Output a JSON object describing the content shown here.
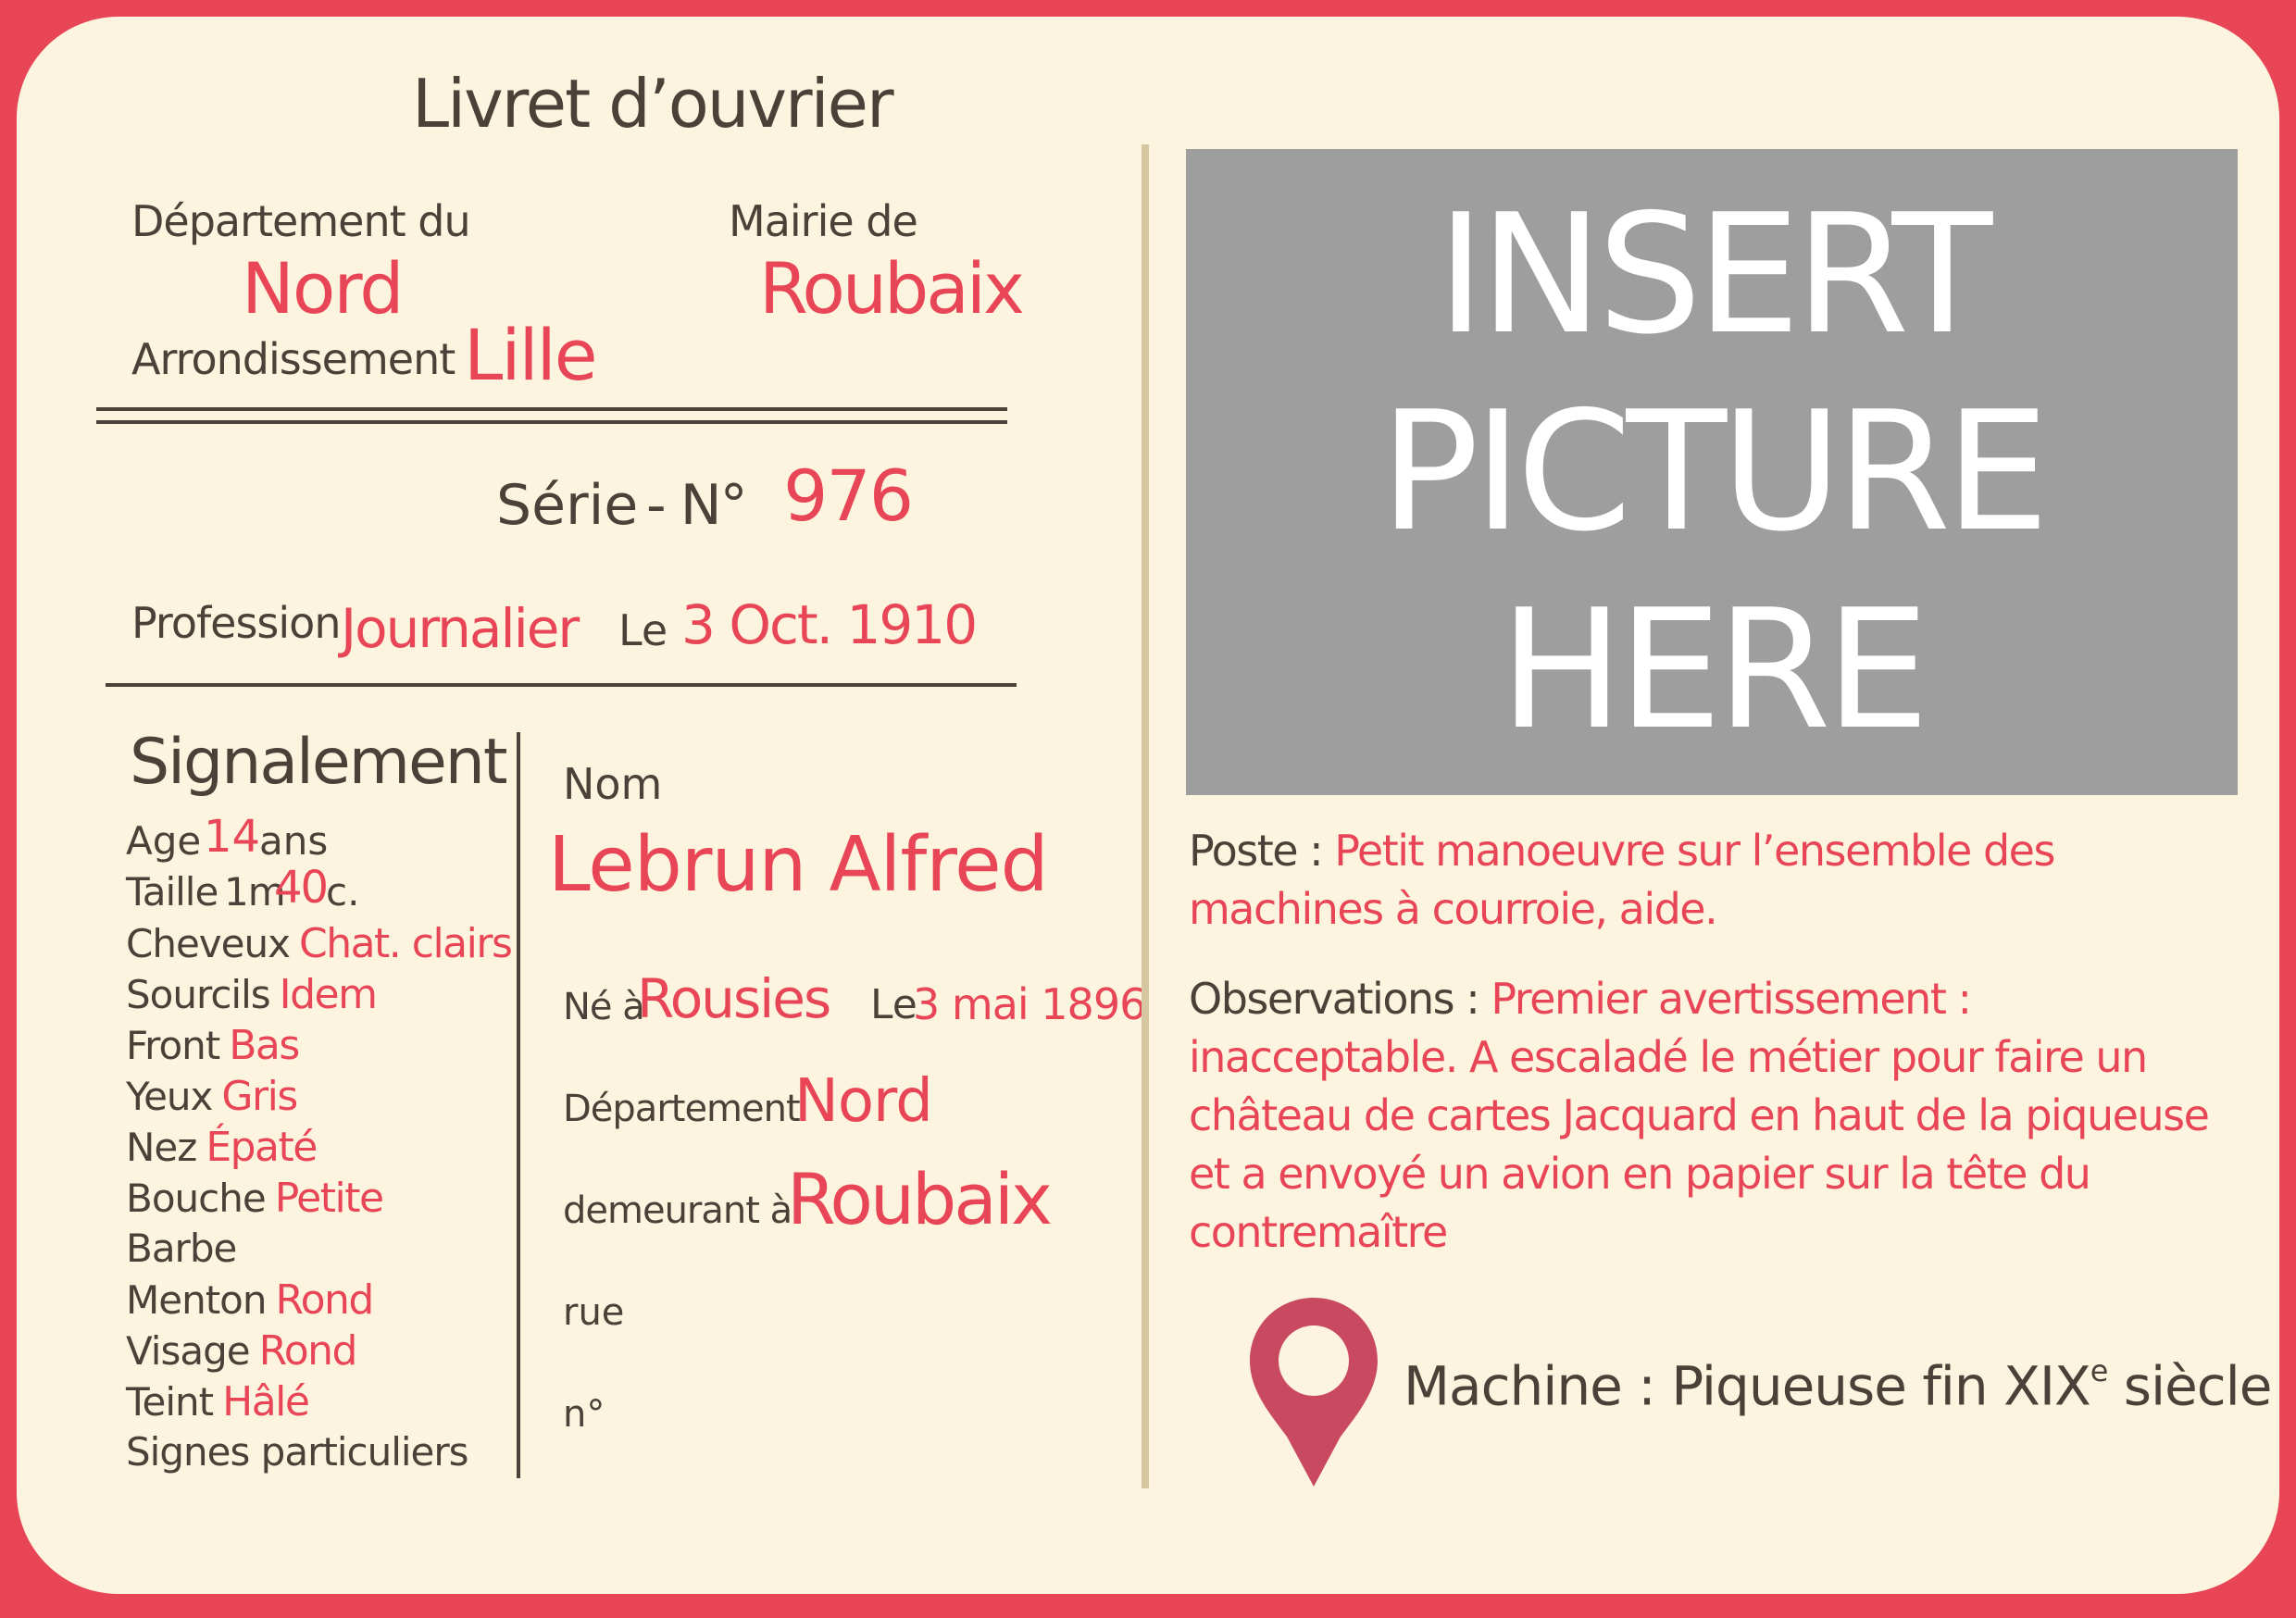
{
  "header": {
    "title": "Livret d’ouvrier"
  },
  "admin": {
    "departement_label": "Département du",
    "departement_value": "Nord",
    "mairie_label": "Mairie de",
    "mairie_value": "Roubaix",
    "arrondissement_label": "Arrondissement",
    "arrondissement_value": "Lille"
  },
  "serie": {
    "label": "Série",
    "no_label": "- N°",
    "number": "976"
  },
  "profession": {
    "label": "Profession",
    "value": "Journalier",
    "date_label": "Le",
    "date_value": "3 Oct. 1910"
  },
  "signalement": {
    "title": "Signalement",
    "age_label": "Age",
    "age_value": "14",
    "age_unit": "ans",
    "taille_label": "Taille",
    "taille_m": "1m",
    "taille_cm": "40",
    "taille_unit": "c.",
    "items": [
      {
        "label": "Cheveux",
        "value": "Chat. clairs"
      },
      {
        "label": "Sourcils",
        "value": "Idem"
      },
      {
        "label": "Front",
        "value": "Bas"
      },
      {
        "label": "Yeux",
        "value": "Gris"
      },
      {
        "label": "Nez",
        "value": "Épaté"
      },
      {
        "label": "Bouche",
        "value": "Petite"
      },
      {
        "label": "Barbe",
        "value": ""
      },
      {
        "label": "Menton",
        "value": "Rond"
      },
      {
        "label": "Visage",
        "value": "Rond"
      },
      {
        "label": "Teint",
        "value": "Hâlé"
      },
      {
        "label": "Signes particuliers",
        "value": ""
      }
    ]
  },
  "identity": {
    "nom_label": "Nom",
    "nom_value": "Lebrun Alfred",
    "ne_label": "Né à",
    "ne_value": "Rousies",
    "le_label": "Le",
    "le_value": "3 mai 1896",
    "dep_label": "Département",
    "dep_value": "Nord",
    "demeurant_label": "demeurant à",
    "demeurant_value": "Roubaix",
    "rue_label": "rue",
    "no_label": "n°"
  },
  "photo": {
    "placeholder": "INSERT\nPICTURE\nHERE"
  },
  "poste": {
    "label": "Poste :",
    "value": "Petit manoeuvre sur l’ensemble des machines à courroie, aide."
  },
  "observations": {
    "label": "Observations :",
    "value": "Premier avertissement : inacceptable. A escaladé le métier pour faire un château de cartes Jacquard en haut de la piqueuse et a envoyé un avion en papier sur la tête du contremaître"
  },
  "machine": {
    "label": "Machine : Piqueuse fin XIX",
    "sup": "e",
    "suffix": " siècle",
    "icon": "map-pin-icon"
  },
  "colors": {
    "border": "#e84556",
    "card": "#fcf4df",
    "text": "#4a4238",
    "accent": "#e84556",
    "photo": "#9e9e9e",
    "divider": "#d6c6a2",
    "pin": "#c94a60"
  }
}
